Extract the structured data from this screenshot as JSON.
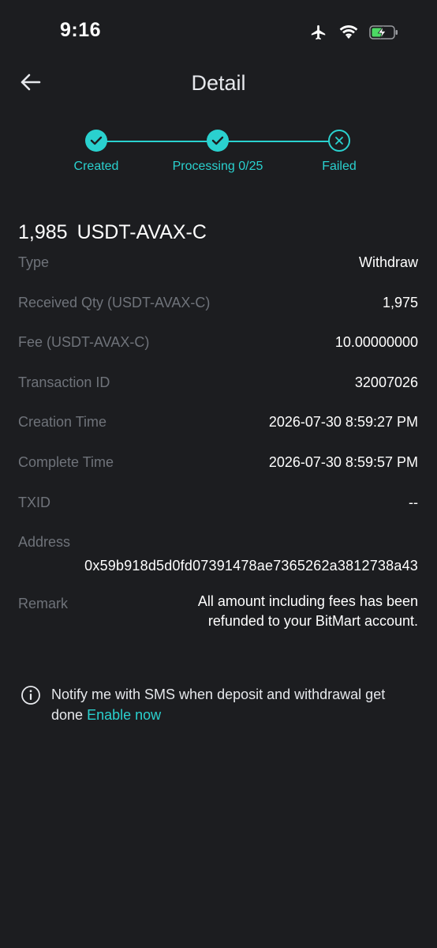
{
  "status_bar": {
    "time": "9:16",
    "icons": [
      "airplane-icon",
      "wifi-icon",
      "battery-charging-icon"
    ]
  },
  "header": {
    "title": "Detail",
    "back_icon": "arrow-left-icon"
  },
  "progress": {
    "steps": [
      {
        "label": "Created",
        "state": "done"
      },
      {
        "label": "Processing 0/25",
        "state": "done"
      },
      {
        "label": "Failed",
        "state": "failed"
      }
    ]
  },
  "amount": {
    "value": "1,985",
    "currency": "USDT-AVAX-C"
  },
  "details": {
    "type_label": "Type",
    "type_value": "Withdraw",
    "received_label": "Received Qty (USDT-AVAX-C)",
    "received_value": "1,975",
    "fee_label": "Fee (USDT-AVAX-C)",
    "fee_value": "10.00000000",
    "txn_id_label": "Transaction ID",
    "txn_id_value": "32007026",
    "creation_label": "Creation Time",
    "creation_value": "2026-07-30 8:59:27 PM",
    "complete_label": "Complete Time",
    "complete_value": "2026-07-30 8:59:57 PM",
    "txid_label": "TXID",
    "txid_value": "--",
    "address_label": "Address",
    "address_value": "0x59b918d5d0fd07391478ae7365262a3812738a43",
    "remark_label": "Remark",
    "remark_line1": "All amount including fees has been",
    "remark_line2": "refunded to your BitMart account."
  },
  "notify": {
    "text": "Notify me with SMS when deposit and withdrawal get done",
    "link": "Enable now"
  },
  "colors": {
    "background": "#1c1d20",
    "accent": "#2ad1cf",
    "label": "#6f737a",
    "value": "#ffffff"
  }
}
